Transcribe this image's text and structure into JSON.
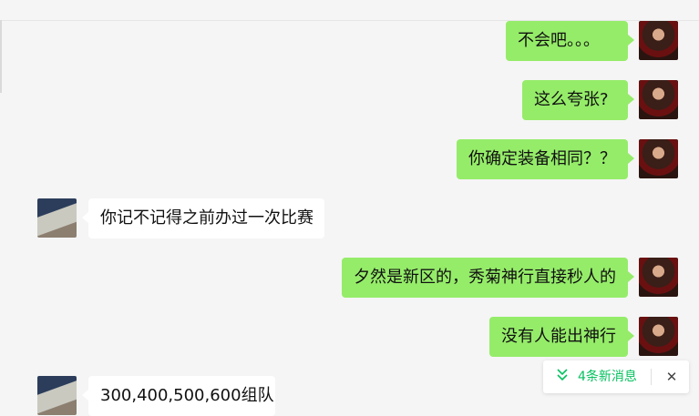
{
  "messages": [
    {
      "side": "out",
      "text": "不会吧。。。"
    },
    {
      "side": "out",
      "text": "这么夸张?"
    },
    {
      "side": "out",
      "text": "你确定装备相同？？"
    },
    {
      "side": "in",
      "text": "你记不记得之前办过一次比赛"
    },
    {
      "side": "out",
      "text": "夕然是新区的，秀菊神行直接秒人的"
    },
    {
      "side": "out",
      "text": "没有人能出神行"
    },
    {
      "side": "in",
      "text": "300,400,500,600组队"
    }
  ],
  "new_messages": {
    "label": "4条新消息",
    "icon": "double-chevron-down-icon",
    "close": "✕"
  },
  "colors": {
    "outgoing_bubble": "#95ec69",
    "incoming_bubble": "#ffffff",
    "background": "#f5f5f5",
    "accent": "#07c160"
  }
}
